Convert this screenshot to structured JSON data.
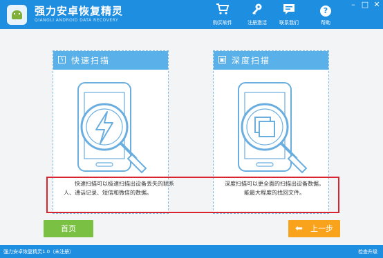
{
  "app": {
    "title": "强力安卓恢复精灵",
    "subtitle": "QIANGLI ANDROID DATA RECOVERY"
  },
  "nav": [
    {
      "label": "购买软件",
      "icon": "cart-icon"
    },
    {
      "label": "注册激活",
      "icon": "key-icon"
    },
    {
      "label": "联系我们",
      "icon": "chat-icon"
    },
    {
      "label": "帮助",
      "icon": "help-icon"
    }
  ],
  "window_controls": {
    "min": "–",
    "max": "□",
    "close": "✕"
  },
  "quick_scan": {
    "title": "快速扫描",
    "description": "快速扫描可以极速扫描出设备丢失的联系人、通话记录、短信和微信的数据。"
  },
  "deep_scan": {
    "title": "深度扫描",
    "description": "深度扫描可以更全面的扫描出设备数据，能最大程度的找回文件。"
  },
  "buttons": {
    "home": "首页",
    "prev": "上一步"
  },
  "statusbar": {
    "left": "强力安卓恢复精灵1.0（未注册）",
    "right": "检查升级"
  },
  "colors": {
    "accent": "#1e8ee0",
    "panel_header": "#5ab1ea",
    "home_button": "#7ac143",
    "prev_button": "#f9a21b",
    "highlight": "#d9232e"
  }
}
